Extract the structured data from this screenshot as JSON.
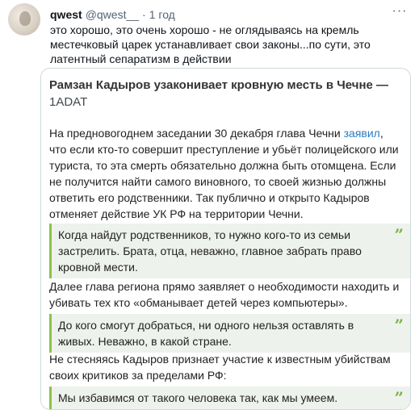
{
  "tweet": {
    "author_name": "qwest",
    "handle": "@qwest__",
    "separator": "·",
    "time": "1 год",
    "text": "это хорошо, это очень хорошо - не оглядываясь на кремль местечковый царек устанавливает свои законы...по сути, это латентный сепаратизм в действии"
  },
  "card": {
    "title": "Рамзан Кадыров узаконивает кровную месть в Чечне —",
    "source": "1ADAT",
    "paragraph1_before_link": "На предновогоднем заседании 30 декабря глава Чечни ",
    "paragraph1_link": "заявил",
    "paragraph1_after_link": ", что если кто-то совершит преступление и убьёт полицейского или туриста, то эта смерть обязательно должна быть отомщена. Если не получится найти самого виновного, то своей жизнью должны ответить его родственники. Так публично и открыто Кадыров отменяет действие УК РФ на территории Чечни.",
    "quote1": "Когда найдут родственников, то нужно кого-то из семьи застрелить. Брата, отца, неважно, главное забрать право кровной мести.",
    "paragraph2": "Далее глава региона прямо заявляет о необходимости находить и убивать тех кто «обманывает детей через компьютеры».",
    "quote2": "До кого смогут добраться, ни одного нельзя оставлять в живых. Неважно, в какой стране.",
    "paragraph3": "Не стесняясь Кадыров признает участие к известным убийствам своих критиков за пределами РФ:",
    "quote3": "Мы избавимся от такого человека так, как мы умеем.",
    "quote_mark": "”"
  },
  "icons": {
    "more": "more-horizontal-icon",
    "quote": "closing-quote-icon",
    "avatar": "user-avatar"
  },
  "colors": {
    "quote_accent": "#8bc34a",
    "quote_bg": "#eef2ec",
    "link": "#2d7bbf"
  }
}
